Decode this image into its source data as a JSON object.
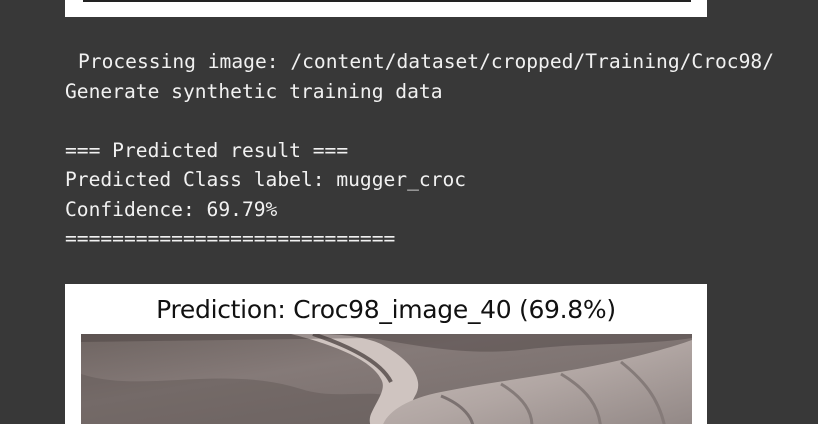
{
  "console": {
    "processing_line": "Processing image: /content/dataset/cropped/Training/Croc98/",
    "generate_line": "Generate synthetic training data",
    "result_header": "=== Predicted result ===",
    "predicted_class": "Predicted Class label: mugger_croc",
    "confidence": "Confidence: 69.79%",
    "separator": "============================"
  },
  "figure": {
    "title": "Prediction: Croc98_image_40 (69.8%)"
  },
  "colors": {
    "background": "#383838",
    "text": "#f1f1f1",
    "figure_bg": "#ffffff"
  }
}
